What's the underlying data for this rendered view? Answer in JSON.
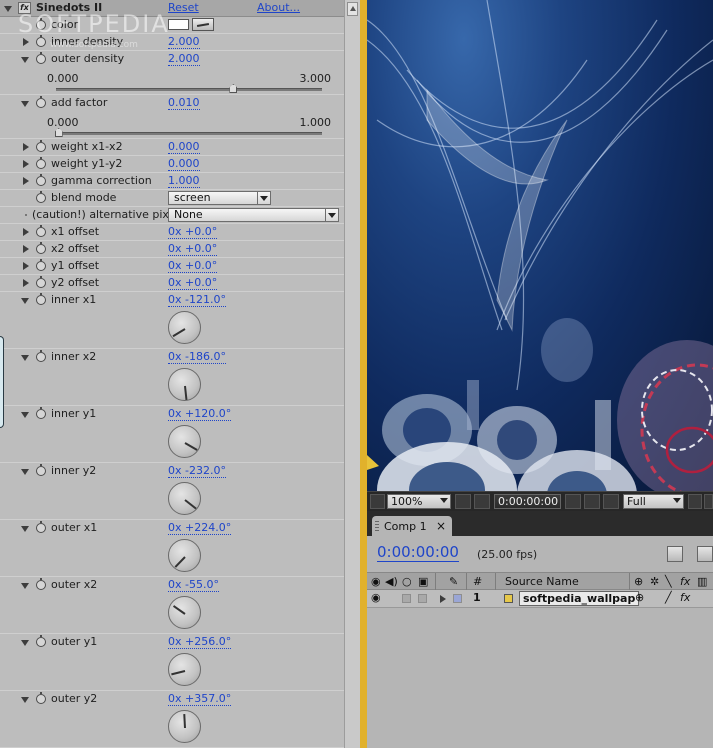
{
  "effect_panel": {
    "effect_name": "Sinedots II",
    "fx_badge": "fx",
    "reset_label": "Reset",
    "about_label": "About...",
    "watermark": "SOFTPEDIA",
    "watermark_sub": "www.softpedia.com",
    "properties": [
      {
        "id": "color",
        "label": "color",
        "type": "color",
        "value_hex": "#ffffff"
      },
      {
        "id": "inner-density",
        "label": "inner density",
        "value": "2.000"
      },
      {
        "id": "outer-density",
        "label": "outer density",
        "value": "2.000",
        "slider": {
          "min": "0.000",
          "max": "3.000",
          "fraction": 0.667
        }
      },
      {
        "id": "add-factor",
        "label": "add factor",
        "value": "0.010",
        "slider": {
          "min": "0.000",
          "max": "1.000",
          "fraction": 0.01
        }
      },
      {
        "id": "weight-x1-x2",
        "label": "weight x1-x2",
        "value": "0.000"
      },
      {
        "id": "weight-y1-y2",
        "label": "weight y1-y2",
        "value": "0.000"
      },
      {
        "id": "gamma-correction",
        "label": "gamma correction",
        "value": "1.000"
      },
      {
        "id": "blend-mode",
        "label": "blend mode",
        "type": "dropdown",
        "value": "screen"
      },
      {
        "id": "alt-pixel",
        "label": "(caution!) alternative pixel",
        "type": "dropdown",
        "value": "None"
      },
      {
        "id": "x1-offset",
        "label": "x1 offset",
        "value": "0x +0.0°"
      },
      {
        "id": "x2-offset",
        "label": "x2 offset",
        "value": "0x +0.0°"
      },
      {
        "id": "y1-offset",
        "label": "y1 offset",
        "value": "0x +0.0°"
      },
      {
        "id": "y2-offset",
        "label": "y2 offset",
        "value": "0x +0.0°"
      },
      {
        "id": "inner-x1",
        "label": "inner x1",
        "value": "0x -121.0°",
        "angle": -121
      },
      {
        "id": "inner-x2",
        "label": "inner x2",
        "value": "0x -186.0°",
        "angle": -186
      },
      {
        "id": "inner-y1",
        "label": "inner y1",
        "value": "0x +120.0°",
        "angle": 120
      },
      {
        "id": "inner-y2",
        "label": "inner y2",
        "value": "0x -232.0°",
        "angle": -232
      },
      {
        "id": "outer-x1",
        "label": "outer x1",
        "value": "0x +224.0°",
        "angle": 224
      },
      {
        "id": "outer-x2",
        "label": "outer x2",
        "value": "0x -55.0°",
        "angle": -55
      },
      {
        "id": "outer-y1",
        "label": "outer y1",
        "value": "0x +256.0°",
        "angle": 256
      },
      {
        "id": "outer-y2",
        "label": "outer y2",
        "value": "0x +357.0°",
        "angle": 357
      }
    ]
  },
  "viewer": {
    "zoom": "100%",
    "timecode": "0:00:00:00",
    "resolution": "Full"
  },
  "timeline": {
    "tab_label": "Comp 1",
    "tab_close": "×",
    "current_time": "0:00:00:00",
    "fps": "(25.00 fps)",
    "col_number": "#",
    "col_source_name": "Source Name",
    "layer": {
      "number": "1",
      "name": "softpedia_wallpap"
    }
  }
}
